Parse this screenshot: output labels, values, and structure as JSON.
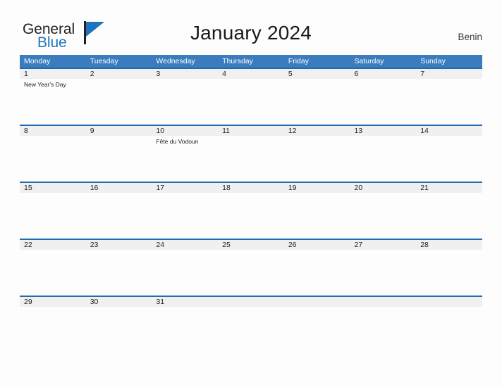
{
  "brand": {
    "word_one": "General",
    "word_two": "Blue",
    "flag_icon": "triangle-flag-icon",
    "accent_color": "#1d74bd"
  },
  "header": {
    "title": "January 2024",
    "country": "Benin"
  },
  "colors": {
    "header_bar": "#3b7cbe",
    "week_separator": "#1f6cb0",
    "date_band": "#f0f0f0",
    "page_background": "#fdfdfd",
    "text": "#222222"
  },
  "calendar": {
    "day_headers": [
      "Monday",
      "Tuesday",
      "Wednesday",
      "Thursday",
      "Friday",
      "Saturday",
      "Sunday"
    ],
    "weeks": [
      {
        "days": [
          {
            "number": "1",
            "event": "New Year's Day"
          },
          {
            "number": "2",
            "event": ""
          },
          {
            "number": "3",
            "event": ""
          },
          {
            "number": "4",
            "event": ""
          },
          {
            "number": "5",
            "event": ""
          },
          {
            "number": "6",
            "event": ""
          },
          {
            "number": "7",
            "event": ""
          }
        ]
      },
      {
        "days": [
          {
            "number": "8",
            "event": ""
          },
          {
            "number": "9",
            "event": ""
          },
          {
            "number": "10",
            "event": "Fête du Vodoun"
          },
          {
            "number": "11",
            "event": ""
          },
          {
            "number": "12",
            "event": ""
          },
          {
            "number": "13",
            "event": ""
          },
          {
            "number": "14",
            "event": ""
          }
        ]
      },
      {
        "days": [
          {
            "number": "15",
            "event": ""
          },
          {
            "number": "16",
            "event": ""
          },
          {
            "number": "17",
            "event": ""
          },
          {
            "number": "18",
            "event": ""
          },
          {
            "number": "19",
            "event": ""
          },
          {
            "number": "20",
            "event": ""
          },
          {
            "number": "21",
            "event": ""
          }
        ]
      },
      {
        "days": [
          {
            "number": "22",
            "event": ""
          },
          {
            "number": "23",
            "event": ""
          },
          {
            "number": "24",
            "event": ""
          },
          {
            "number": "25",
            "event": ""
          },
          {
            "number": "26",
            "event": ""
          },
          {
            "number": "27",
            "event": ""
          },
          {
            "number": "28",
            "event": ""
          }
        ]
      },
      {
        "days": [
          {
            "number": "29",
            "event": ""
          },
          {
            "number": "30",
            "event": ""
          },
          {
            "number": "31",
            "event": ""
          },
          {
            "number": "",
            "event": ""
          },
          {
            "number": "",
            "event": ""
          },
          {
            "number": "",
            "event": ""
          },
          {
            "number": "",
            "event": ""
          }
        ]
      }
    ]
  }
}
